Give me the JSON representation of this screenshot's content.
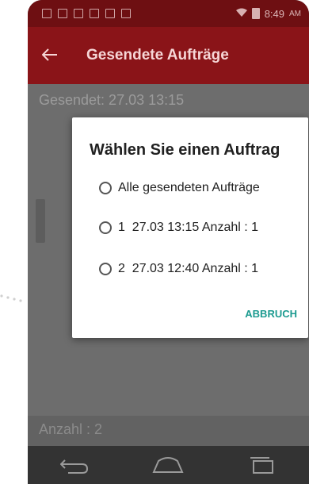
{
  "status_bar": {
    "time": "8:49",
    "ampm": "AM"
  },
  "toolbar": {
    "title": "Gesendete Aufträge"
  },
  "content": {
    "sent_label": "Gesendet: 27.03 13:15",
    "count_label": "Anzahl : 2"
  },
  "dialog": {
    "title": "Wählen Sie einen Auftrag",
    "options": [
      {
        "label": "Alle gesendeten Aufträge"
      },
      {
        "label": "1  27.03 13:15 Anzahl : 1"
      },
      {
        "label": "2  27.03 12:40 Anzahl : 1"
      }
    ],
    "cancel_label": "ABBRUCH"
  },
  "icons": {
    "back": "back-arrow-icon",
    "nav_back": "nav-back-icon",
    "nav_home": "nav-home-icon",
    "nav_recents": "nav-recents-icon",
    "wifi": "wifi-icon",
    "battery": "battery-icon"
  },
  "colors": {
    "status_bar": "#6e0f12",
    "toolbar": "#8a1418",
    "accent": "#1b9a8f"
  }
}
